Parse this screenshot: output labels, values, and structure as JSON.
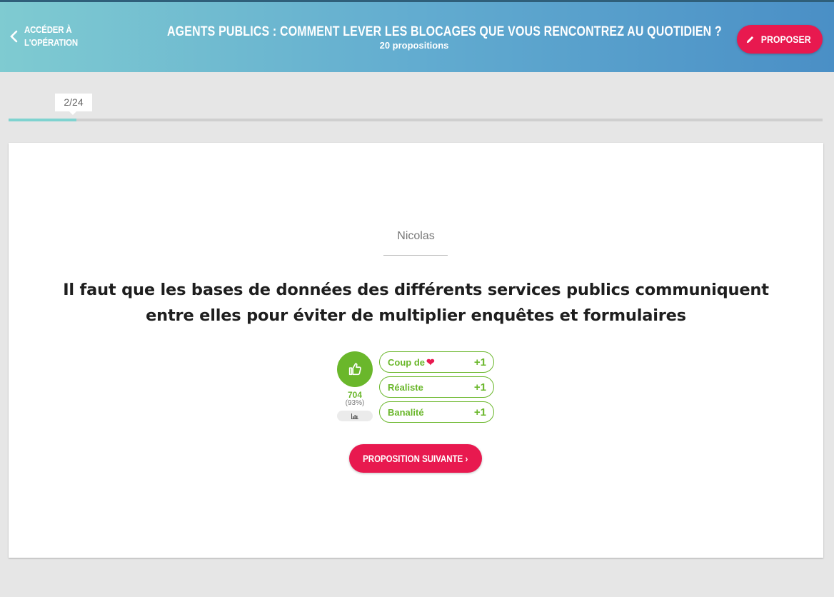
{
  "header": {
    "back_line1": "ACCÉDER À",
    "back_line2": "L'OPÉRATION",
    "title": "AGENTS PUBLICS : COMMENT LEVER LES BLOCAGES QUE VOUS RENCONTREZ AU QUOTIDIEN ?",
    "subtitle": "20 propositions",
    "propose_label": "PROPOSER"
  },
  "progress": {
    "label": "2/24",
    "current": 2,
    "total": 24
  },
  "proposal": {
    "author": "Nicolas",
    "text": "Il faut que les bases de données des différents services publics communiquent entre elles pour éviter de multiplier enquêtes et formulaires"
  },
  "vote": {
    "count": "704",
    "percent": "(93%)"
  },
  "qualifications": [
    {
      "label": "Coup de",
      "icon": "heart-icon",
      "count": "+1"
    },
    {
      "label": "Réaliste",
      "count": "+1"
    },
    {
      "label": "Banalité",
      "count": "+1"
    }
  ],
  "next_label": "PROPOSITION SUIVANTE",
  "colors": {
    "accent": "#e8194f",
    "agree": "#6ab72b",
    "progress": "#7fd3d0"
  }
}
